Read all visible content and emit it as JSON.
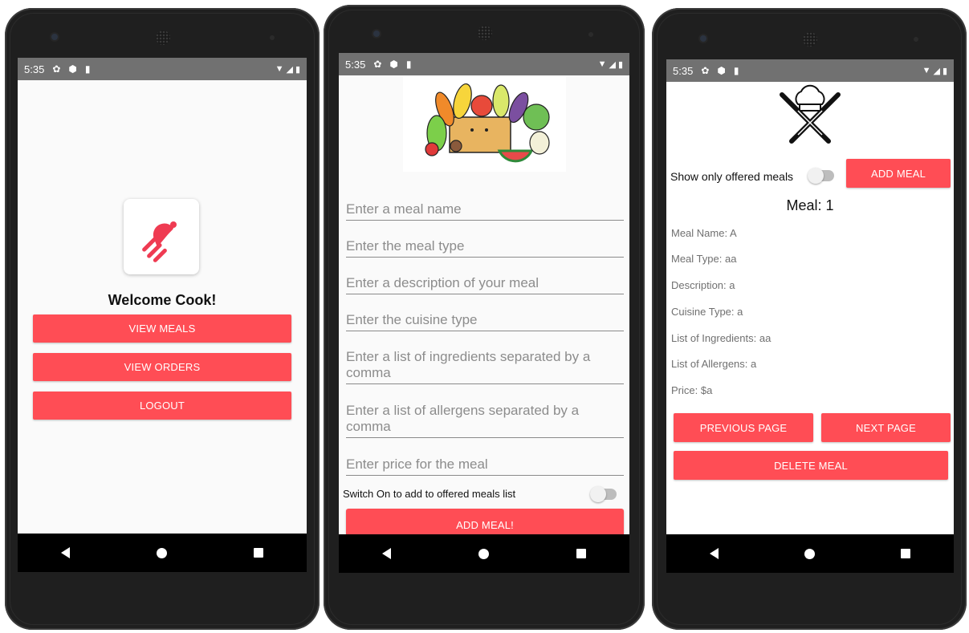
{
  "status_bar": {
    "time": "5:35"
  },
  "screen1": {
    "welcome": "Welcome Cook!",
    "buttons": [
      "VIEW MEALS",
      "VIEW ORDERS",
      "LOGOUT"
    ]
  },
  "screen2": {
    "fields": [
      "Enter a meal name",
      "Enter the meal type",
      "Enter a description of your meal",
      "Enter the cuisine type",
      "Enter a list of ingredients separated by a comma",
      "Enter a list of allergens separated by a comma",
      "Enter price for the meal"
    ],
    "switch_label": "Switch On to add to offered meals list",
    "add_button": "ADD MEAL!"
  },
  "screen3": {
    "switch_label": "Show only offered meals",
    "add_button": "ADD MEAL",
    "meal_title": "Meal: 1",
    "details": [
      "Meal Name: A",
      "Meal Type: aa",
      " Description: a",
      " Cuisine Type: a",
      " List of Ingredients: aa",
      " List of Allergens: a",
      " Price: $a"
    ],
    "prev_button": "PREVIOUS PAGE",
    "next_button": "NEXT PAGE",
    "delete_button": "DELETE MEAL"
  },
  "colors": {
    "accent": "#ff4d55",
    "status_bar": "#717171",
    "nav_bar": "#000000"
  }
}
